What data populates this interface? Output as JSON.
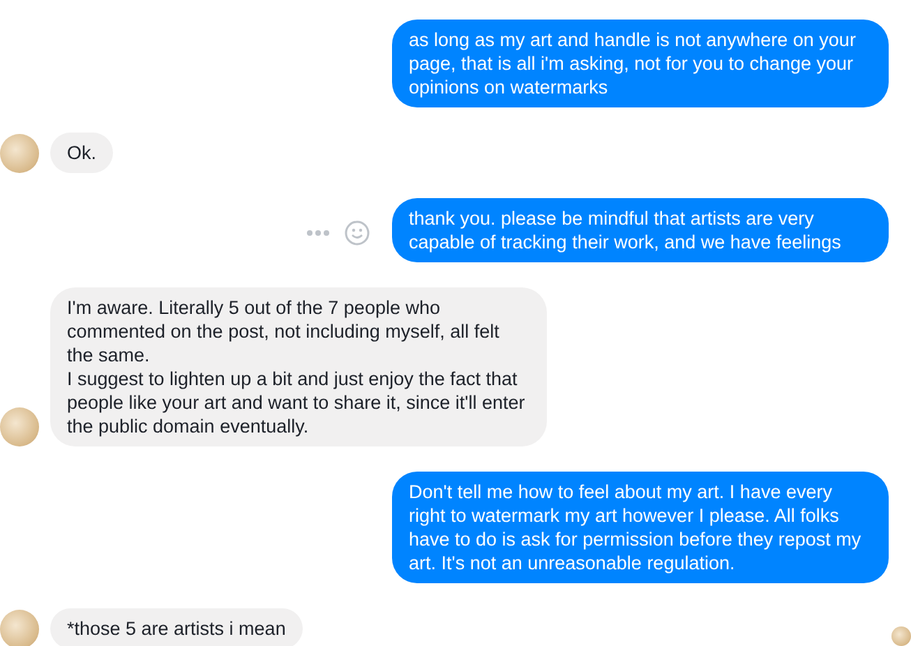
{
  "messages": [
    {
      "kind": "sent",
      "text": "as long as my art and handle is not anywhere on your page, that is all i'm asking, not for you to change your opinions on watermarks",
      "actions_shown": false
    },
    {
      "kind": "received",
      "text": "Ok.",
      "actions_shown": false
    },
    {
      "kind": "sent",
      "text": "thank you. please be mindful that artists are very capable of tracking their work, and we have feelings",
      "actions_shown": true
    },
    {
      "kind": "received",
      "text": "I'm aware. Literally 5 out of the 7 people who commented on the post, not including myself, all felt the same.\nI suggest to lighten up a bit and just enjoy the fact that people like your art and want to share it, since it'll enter the public domain eventually.",
      "actions_shown": false
    },
    {
      "kind": "sent",
      "text": "Don't tell me how to feel about my art. I have every right to watermark my art however I please. All folks have to do is ask for permission before they repost my art. It's not an unreasonable regulation.",
      "actions_shown": false
    },
    {
      "kind": "received",
      "text": "*those 5 are artists i mean",
      "actions_shown": false
    }
  ],
  "seen": true
}
